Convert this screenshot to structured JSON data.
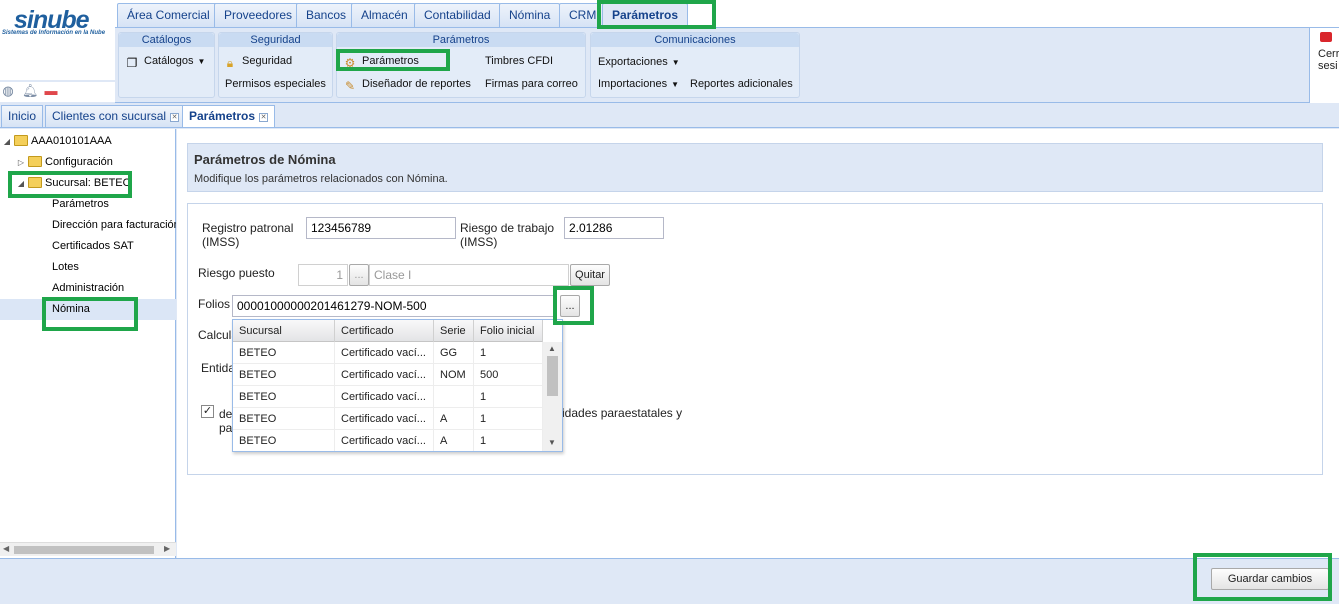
{
  "logo": {
    "brand": "sinube",
    "tagline": "Sistemas de Información en la Nube"
  },
  "top_tabs": [
    "Área Comercial",
    "Proveedores",
    "Bancos",
    "Almacén",
    "Contabilidad",
    "Nómina",
    "CRM",
    "Parámetros"
  ],
  "ribbon": {
    "catalogos": {
      "title": "Catálogos",
      "catalogos": "Catálogos"
    },
    "seguridad": {
      "title": "Seguridad",
      "seguridad": "Seguridad",
      "permisos": "Permisos especiales"
    },
    "parametros": {
      "title": "Parámetros",
      "parametros": "Parámetros",
      "timbres": "Timbres CFDI",
      "disenador": "Diseñador de reportes",
      "firmas": "Firmas para correo"
    },
    "comunicaciones": {
      "title": "Comunicaciones",
      "exportaciones": "Exportaciones",
      "importaciones": "Importaciones",
      "reportes": "Reportes adicionales"
    },
    "logout_line1": "Cerr",
    "logout_line2": "sesi"
  },
  "page_tabs": {
    "inicio": "Inicio",
    "clientes": "Clientes con sucursal",
    "parametros": "Parámetros"
  },
  "tree": {
    "root": "AAA010101AAA",
    "configuracion": "Configuración",
    "sucursal": "Sucursal: BETEO",
    "children": [
      "Parámetros",
      "Dirección para facturación",
      "Certificados SAT",
      "Lotes",
      "Administración",
      "Nómina"
    ]
  },
  "panel": {
    "title": "Parámetros de Nómina",
    "subtitle": "Modifique los parámetros relacionados con Nómina."
  },
  "form": {
    "registro_label_1": "Registro patronal",
    "registro_label_2": "(IMSS)",
    "registro_value": "123456789",
    "riesgo_label_1": "Riesgo de trabajo",
    "riesgo_label_2": "(IMSS)",
    "riesgo_value": "2.01286",
    "riesgo_puesto_label": "Riesgo puesto",
    "riesgo_puesto_num": "1",
    "riesgo_puesto_clase": "Clase I",
    "ellipsis": "...",
    "quitar": "Quitar",
    "folios_label": "Folios",
    "folios_value": "00001000000201461279-NOM-500",
    "calcula_label": "Calcula",
    "entidad_label": "Entida",
    "check_text_1": "de",
    "check_text_2": "pa",
    "check_text_right": "idades paraestatales y"
  },
  "grid": {
    "headers": [
      "Sucursal",
      "Certificado",
      "Serie",
      "Folio inicial"
    ],
    "rows": [
      [
        "BETEO",
        "Certificado vací...",
        "GG",
        "1"
      ],
      [
        "BETEO",
        "Certificado vací...",
        "NOM",
        "500"
      ],
      [
        "BETEO",
        "Certificado vací...",
        "",
        "1"
      ],
      [
        "BETEO",
        "Certificado vací...",
        "A",
        "1"
      ],
      [
        "BETEO",
        "Certificado vací...",
        "A",
        "1"
      ]
    ]
  },
  "footer": {
    "save": "Guardar cambios"
  },
  "colors": {
    "accent": "#15428b",
    "highlight": "#1fa64a",
    "panel": "#dfe8f6"
  }
}
